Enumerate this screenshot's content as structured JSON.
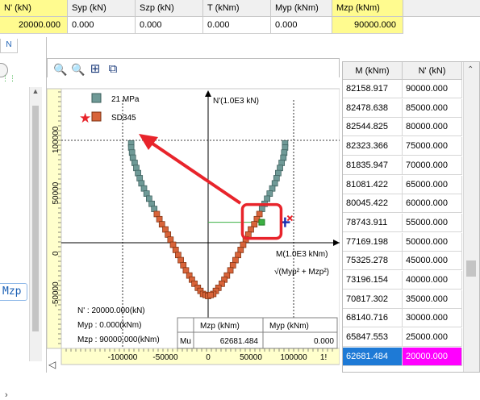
{
  "top_table": {
    "headers": [
      "N' (kN)",
      "Syp (kN)",
      "Szp (kN)",
      "T (kNm)",
      "Myp (kNm)",
      "Mzp (kNm)"
    ],
    "values": [
      "20000.000",
      "0.000",
      "0.000",
      "0.000",
      "0.000",
      "90000.000"
    ]
  },
  "left_strip": {
    "tab_text": "N",
    "label": "Mzp"
  },
  "toolbar": {
    "icons": [
      "zoom-in-icon",
      "zoom-out-icon",
      "fit-all-icon",
      "zoom-window-icon"
    ]
  },
  "plot": {
    "legend": [
      {
        "label": "21 MPa",
        "color": "#6f9a97"
      },
      {
        "label": "SD345",
        "color": "#d8643a"
      }
    ],
    "y_axis_title": "N'(1.0E3 kN)",
    "x_axis_title": "M(1.0E3 kNm)",
    "x_axis_formula": "√(Myp² + Mzp²)",
    "y_ticks": [
      "100000",
      "50000",
      "0",
      "-50000"
    ],
    "x_ticks": [
      "-100000",
      "-50000",
      "0",
      "50000",
      "100000",
      "1!"
    ],
    "info_lines": [
      "N' : 20000.000(kN)",
      "Myp : 0.000(kNm)",
      "Mzp : 90000.000(kNm)"
    ],
    "result_table": {
      "headers": [
        "Mzp (kNm)",
        "Myp (kNm)"
      ],
      "row_label": "Mu",
      "values": [
        "62681.484",
        "0.000"
      ]
    },
    "colors": {
      "concrete": "#6f9a97",
      "steel": "#d8643a",
      "highlight": "#e8242b",
      "point": "#1b2fb0",
      "green": "#3cb043"
    }
  },
  "chart_data": {
    "type": "scatter",
    "xlabel": "M(1.0E3 kNm)",
    "ylabel": "N'(1.0E3 kN)",
    "xlim": [
      -130000,
      130000
    ],
    "ylim": [
      -70000,
      110000
    ],
    "series": [
      {
        "name": "21 MPa",
        "x": [
          -90000,
          -90000,
          -89000,
          -88000,
          -86000,
          -84000,
          -82000,
          -80000,
          -78000,
          -75000,
          -72000,
          -69000,
          -66000,
          -63000,
          90000,
          90000,
          89000,
          88000,
          86000,
          84000,
          82000,
          80000,
          78000,
          75000,
          72000,
          69000,
          66000,
          63000
        ],
        "y": [
          97000,
          93000,
          88000,
          83000,
          78000,
          73000,
          68000,
          63000,
          58000,
          53000,
          48000,
          43000,
          38000,
          33000,
          97000,
          93000,
          88000,
          83000,
          78000,
          73000,
          68000,
          63000,
          58000,
          53000,
          48000,
          43000,
          38000,
          33000
        ]
      },
      {
        "name": "SD345",
        "x": [
          -60000,
          -57000,
          -54000,
          -50000,
          -47000,
          -44000,
          -41000,
          -38000,
          -35000,
          -32000,
          -29000,
          -26000,
          -22000,
          -19000,
          -16000,
          -12000,
          -9000,
          -6000,
          -3000,
          0,
          60000,
          57000,
          54000,
          50000,
          47000,
          44000,
          41000,
          38000,
          35000,
          32000,
          29000,
          26000,
          22000,
          19000,
          16000,
          12000,
          9000,
          6000,
          3000
        ],
        "y": [
          28000,
          23000,
          18000,
          13000,
          8000,
          3000,
          -2000,
          -7000,
          -12000,
          -17000,
          -22000,
          -27000,
          -32000,
          -36000,
          -40000,
          -44000,
          -47000,
          -50000,
          -51000,
          -52000,
          28000,
          23000,
          18000,
          13000,
          8000,
          3000,
          -2000,
          -7000,
          -12000,
          -17000,
          -22000,
          -27000,
          -32000,
          -36000,
          -40000,
          -44000,
          -47000,
          -50000,
          -51000
        ]
      },
      {
        "name": "",
        "x": [
          62681.484
        ],
        "y": [
          20000
        ]
      },
      {
        "name": "",
        "x": [
          90000
        ],
        "y": [
          20000
        ]
      }
    ]
  },
  "right_table": {
    "headers": [
      "M (kNm)",
      "N' (kN)"
    ],
    "rows": [
      [
        "82158.917",
        "90000.000"
      ],
      [
        "82478.638",
        "85000.000"
      ],
      [
        "82544.825",
        "80000.000"
      ],
      [
        "82323.366",
        "75000.000"
      ],
      [
        "81835.947",
        "70000.000"
      ],
      [
        "81081.422",
        "65000.000"
      ],
      [
        "80045.422",
        "60000.000"
      ],
      [
        "78743.911",
        "55000.000"
      ],
      [
        "77169.198",
        "50000.000"
      ],
      [
        "75325.278",
        "45000.000"
      ],
      [
        "73196.154",
        "40000.000"
      ],
      [
        "70817.302",
        "35000.000"
      ],
      [
        "68140.716",
        "30000.000"
      ],
      [
        "65847.553",
        "25000.000"
      ],
      [
        "62681.484",
        "20000.000"
      ]
    ],
    "selected_row": 14,
    "selected_colors": {
      "m_bg": "#1e7ad6",
      "n_bg": "#ff00ff"
    }
  }
}
